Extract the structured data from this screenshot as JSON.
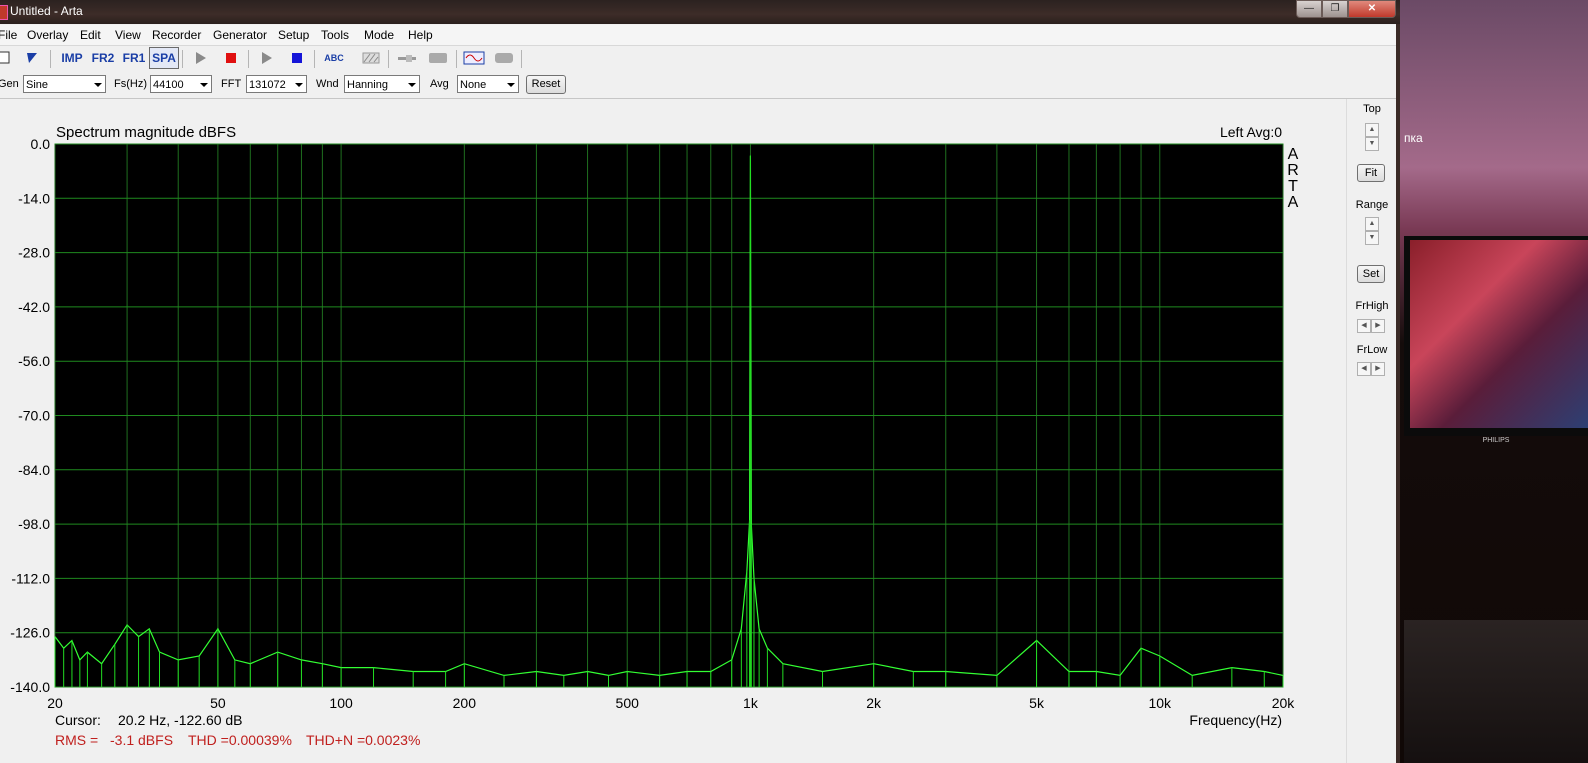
{
  "window": {
    "title": "Untitled - Arta",
    "controls": {
      "minimize": "—",
      "maximize": "❐",
      "close": "✕"
    }
  },
  "desktop": {
    "right_label": "пка",
    "tv_brand": "PHILIPS"
  },
  "menu": [
    "File",
    "Overlay",
    "Edit",
    "View",
    "Recorder",
    "Generator",
    "Setup",
    "Tools",
    "Mode",
    "Help"
  ],
  "toolbar": {
    "imp": "IMP",
    "fr2": "FR2",
    "fr1": "FR1",
    "spa": "SPA",
    "abc": "ABC"
  },
  "controls": {
    "gen_label": "Gen",
    "gen_value": "Sine",
    "fs_label": "Fs(Hz)",
    "fs_value": "44100",
    "fft_label": "FFT",
    "fft_value": "131072",
    "wnd_label": "Wnd",
    "wnd_value": "Hanning",
    "avg_label": "Avg",
    "avg_value": "None",
    "reset_label": "Reset"
  },
  "side_panel": {
    "top_label": "Top",
    "fit_label": "Fit",
    "range_label": "Range",
    "set_label": "Set",
    "frhigh_label": "FrHigh",
    "frlow_label": "FrLow"
  },
  "colors": {
    "plot_bg": "#000000",
    "grid": "#1f7a1f",
    "trace": "#33ff33",
    "status_red": "#c0201e"
  },
  "chart_data": {
    "type": "line",
    "title": "Spectrum magnitude dBFS",
    "channel_label": "Left  Avg:0",
    "watermark": [
      "A",
      "R",
      "T",
      "A"
    ],
    "xlabel": "Frequency(Hz)",
    "ylabel": "",
    "x_scale": "log",
    "xlim": [
      20,
      20000
    ],
    "ylim": [
      -140,
      0
    ],
    "grid": true,
    "y_ticks": [
      "0.0",
      "-14.0",
      "-28.0",
      "-42.0",
      "-56.0",
      "-70.0",
      "-84.0",
      "-98.0",
      "-112.0",
      "-126.0",
      "-140.0"
    ],
    "x_ticks": [
      {
        "value": 20,
        "label": "20"
      },
      {
        "value": 50,
        "label": "50"
      },
      {
        "value": 100,
        "label": "100"
      },
      {
        "value": 200,
        "label": "200"
      },
      {
        "value": 500,
        "label": "500"
      },
      {
        "value": 1000,
        "label": "1k"
      },
      {
        "value": 2000,
        "label": "2k"
      },
      {
        "value": 5000,
        "label": "5k"
      },
      {
        "value": 10000,
        "label": "10k"
      },
      {
        "value": 20000,
        "label": "20k"
      }
    ],
    "series": [
      {
        "x": [
          20,
          21,
          22,
          23,
          24,
          26,
          28,
          30,
          32,
          34,
          36,
          40,
          45,
          50,
          55,
          60,
          70,
          80,
          90,
          100,
          120,
          150,
          180,
          200,
          250,
          300,
          350,
          400,
          450,
          500,
          600,
          700,
          800,
          900,
          950,
          980,
          995,
          1000,
          1005,
          1020,
          1050,
          1100,
          1200,
          1500,
          2000,
          2500,
          3000,
          4000,
          5000,
          6000,
          7000,
          8000,
          9000,
          10000,
          12000,
          15000,
          18000,
          20000
        ],
        "y": [
          -127,
          -130,
          -128,
          -133,
          -131,
          -134,
          -129,
          -124,
          -127,
          -125,
          -131,
          -133,
          -132,
          -125,
          -133,
          -134,
          -131,
          -133,
          -134,
          -135,
          -135,
          -136,
          -136,
          -134,
          -137,
          -136,
          -137,
          -136,
          -137,
          -136,
          -137,
          -136,
          -136,
          -133,
          -125,
          -110,
          -97,
          -3.0,
          -98,
          -112,
          -125,
          -130,
          -134,
          -136,
          -134,
          -136,
          -136,
          -137,
          -128,
          -136,
          -136,
          -137,
          -130,
          -132,
          -137,
          -135,
          -136,
          -137
        ]
      }
    ]
  },
  "status": {
    "cursor_label": "Cursor:",
    "cursor_value": "20.2 Hz, -122.60 dB",
    "rms_label": "RMS =",
    "rms_value": "-3.1 dBFS",
    "thd": "THD =0.00039%",
    "thdn": "THD+N =0.0023%"
  }
}
